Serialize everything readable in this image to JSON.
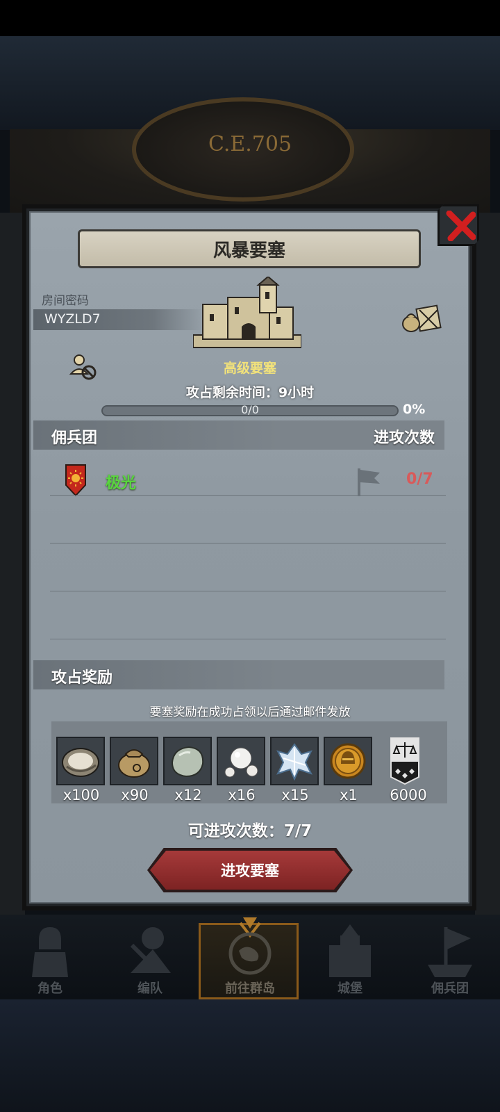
{
  "background": {
    "era_label": "C.E.705"
  },
  "dialog": {
    "title": "风暴要塞",
    "room_label": "房间密码",
    "room_code": "WYZLD7",
    "fortress_name": "高级要塞",
    "remaining_time": "攻占剩余时间：9小时",
    "progress_text": "0/0",
    "progress_percent_text": "0%",
    "progress_fraction": 0,
    "mercenary_header": "佣兵团",
    "attack_count_header": "进攻次数",
    "mercenaries": [
      {
        "name": "极光",
        "attack_count": "0/7"
      }
    ],
    "reward_header": "攻占奖励",
    "reward_note": "要塞奖励在成功占领以后通过邮件发放",
    "rewards": [
      {
        "icon": "oyster-icon",
        "qty": "x100"
      },
      {
        "icon": "sack-icon",
        "qty": "x90"
      },
      {
        "icon": "stone-icon",
        "qty": "x12"
      },
      {
        "icon": "pearl-icon",
        "qty": "x16"
      },
      {
        "icon": "crystal-icon",
        "qty": "x15"
      },
      {
        "icon": "helmet-coin-icon",
        "qty": "x1"
      },
      {
        "icon": "justice-banner-icon",
        "qty": "6000"
      }
    ],
    "attempts_text": "可进攻次数：7/7",
    "attack_button": "进攻要塞"
  },
  "nav": {
    "items": [
      {
        "label": "角色",
        "icon": "knight-icon"
      },
      {
        "label": "编队",
        "icon": "formation-icon"
      },
      {
        "label": "前往群岛",
        "icon": "island-compass-icon"
      },
      {
        "label": "城堡",
        "icon": "castle-icon"
      },
      {
        "label": "佣兵团",
        "icon": "ship-banner-icon"
      }
    ]
  },
  "colors": {
    "panel": "#8f99a1",
    "accent_red": "#a63a3a",
    "merc_green": "#59d63e",
    "count_red": "#d85a5a",
    "fortress_gold": "#f2e27a"
  }
}
